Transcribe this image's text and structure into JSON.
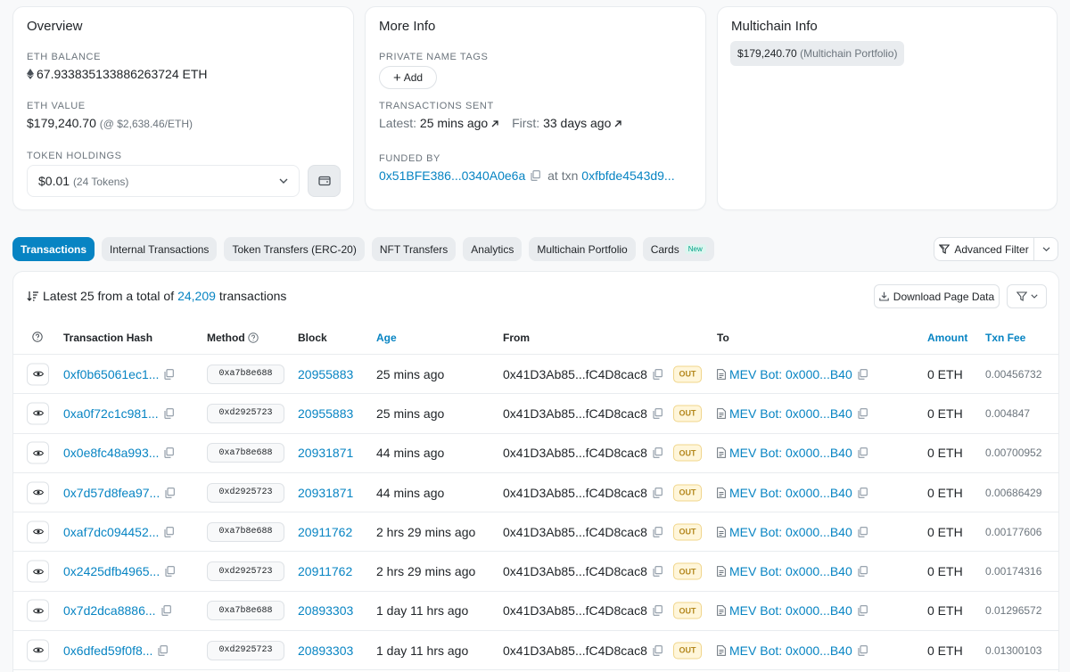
{
  "overview": {
    "title": "Overview",
    "eth_balance_label": "ETH BALANCE",
    "eth_balance_value": "67.933835133886263724 ETH",
    "eth_value_label": "ETH VALUE",
    "eth_value_amount": "$179,240.70",
    "eth_value_rate": "(@ $2,638.46/ETH)",
    "token_holdings_label": "TOKEN HOLDINGS",
    "token_holdings_value": "$0.01",
    "token_holdings_count": "(24 Tokens)"
  },
  "more_info": {
    "title": "More Info",
    "private_tags_label": "PRIVATE NAME TAGS",
    "add_label": "Add",
    "tx_sent_label": "TRANSACTIONS SENT",
    "latest_label": "Latest:",
    "latest_value": "25 mins ago",
    "first_label": "First:",
    "first_value": "33 days ago",
    "funded_by_label": "FUNDED BY",
    "funded_by_address": "0x51BFE386...0340A0e6a",
    "at_txn_label": "at txn",
    "funded_txn": "0xfbfde4543d9..."
  },
  "multichain": {
    "title": "Multichain Info",
    "portfolio_amount": "$179,240.70",
    "portfolio_label": "(Multichain Portfolio)"
  },
  "tabs": [
    {
      "label": "Transactions",
      "active": true
    },
    {
      "label": "Internal Transactions"
    },
    {
      "label": "Token Transfers (ERC-20)"
    },
    {
      "label": "NFT Transfers"
    },
    {
      "label": "Analytics"
    },
    {
      "label": "Multichain Portfolio"
    },
    {
      "label": "Cards",
      "badge": "New"
    }
  ],
  "advanced_filter_label": "Advanced Filter",
  "summary": {
    "prefix": "Latest 25 from a total of",
    "total": "24,209",
    "suffix": "transactions"
  },
  "download_label": "Download Page Data",
  "columns": {
    "hash": "Transaction Hash",
    "method": "Method",
    "block": "Block",
    "age": "Age",
    "from": "From",
    "to": "To",
    "amount": "Amount",
    "fee": "Txn Fee"
  },
  "transactions": [
    {
      "hash": "0xf0b65061ec1...",
      "method": "0xa7b8e688",
      "block": "20955883",
      "age": "25 mins ago",
      "from": "0x41D3Ab85...fC4D8cac8",
      "dir": "OUT",
      "to": "MEV Bot: 0x000...B40",
      "amount": "0 ETH",
      "fee": "0.00456732"
    },
    {
      "hash": "0xa0f72c1c981...",
      "method": "0xd2925723",
      "block": "20955883",
      "age": "25 mins ago",
      "from": "0x41D3Ab85...fC4D8cac8",
      "dir": "OUT",
      "to": "MEV Bot: 0x000...B40",
      "amount": "0 ETH",
      "fee": "0.004847"
    },
    {
      "hash": "0x0e8fc48a993...",
      "method": "0xa7b8e688",
      "block": "20931871",
      "age": "44 mins ago",
      "from": "0x41D3Ab85...fC4D8cac8",
      "dir": "OUT",
      "to": "MEV Bot: 0x000...B40",
      "amount": "0 ETH",
      "fee": "0.00700952"
    },
    {
      "hash": "0x7d57d8fea97...",
      "method": "0xd2925723",
      "block": "20931871",
      "age": "44 mins ago",
      "from": "0x41D3Ab85...fC4D8cac8",
      "dir": "OUT",
      "to": "MEV Bot: 0x000...B40",
      "amount": "0 ETH",
      "fee": "0.00686429"
    },
    {
      "hash": "0xaf7dc094452...",
      "method": "0xa7b8e688",
      "block": "20911762",
      "age": "2 hrs 29 mins ago",
      "from": "0x41D3Ab85...fC4D8cac8",
      "dir": "OUT",
      "to": "MEV Bot: 0x000...B40",
      "amount": "0 ETH",
      "fee": "0.00177606"
    },
    {
      "hash": "0x2425dfb4965...",
      "method": "0xd2925723",
      "block": "20911762",
      "age": "2 hrs 29 mins ago",
      "from": "0x41D3Ab85...fC4D8cac8",
      "dir": "OUT",
      "to": "MEV Bot: 0x000...B40",
      "amount": "0 ETH",
      "fee": "0.00174316"
    },
    {
      "hash": "0x7d2dca8886...",
      "method": "0xa7b8e688",
      "block": "20893303",
      "age": "1 day 11 hrs ago",
      "from": "0x41D3Ab85...fC4D8cac8",
      "dir": "OUT",
      "to": "MEV Bot: 0x000...B40",
      "amount": "0 ETH",
      "fee": "0.01296572"
    },
    {
      "hash": "0x6dfed59f0f8...",
      "method": "0xd2925723",
      "block": "20893303",
      "age": "1 day 11 hrs ago",
      "from": "0x41D3Ab85...fC4D8cac8",
      "dir": "OUT",
      "to": "MEV Bot: 0x000...B40",
      "amount": "0 ETH",
      "fee": "0.01300103"
    }
  ],
  "colors": {
    "accent": "#0784c3",
    "out_badge": "#fff6da",
    "new_badge": "#00a186"
  }
}
